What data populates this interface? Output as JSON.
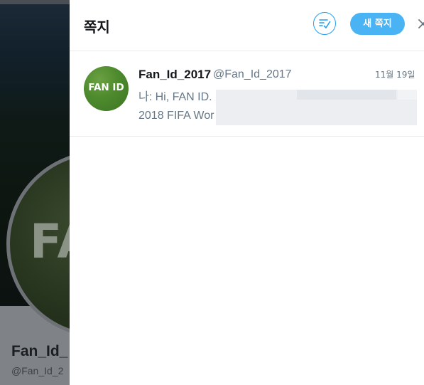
{
  "background_profile": {
    "avatar_text": "FAN",
    "name": "Fan_Id_",
    "handle": "@Fan_Id_2"
  },
  "panel": {
    "title": "쪽지",
    "new_message_label": "새 쪽지",
    "mark_all_read_icon": "mark-read-icon",
    "close_icon": "close-icon"
  },
  "conversations": [
    {
      "avatar_text": "FAN ID",
      "name": "Fan_Id_2017",
      "handle": "@Fan_Id_2017",
      "time": "11월 19일",
      "snippet_line1": "나: Hi, FAN ID.",
      "snippet_line2": "2018 FIFA Wor"
    }
  ],
  "colors": {
    "accent": "#1da1f2",
    "button_bg": "#4ab3f4",
    "text_primary": "#14171a",
    "text_secondary": "#657786",
    "divider": "#e6ecf0"
  }
}
